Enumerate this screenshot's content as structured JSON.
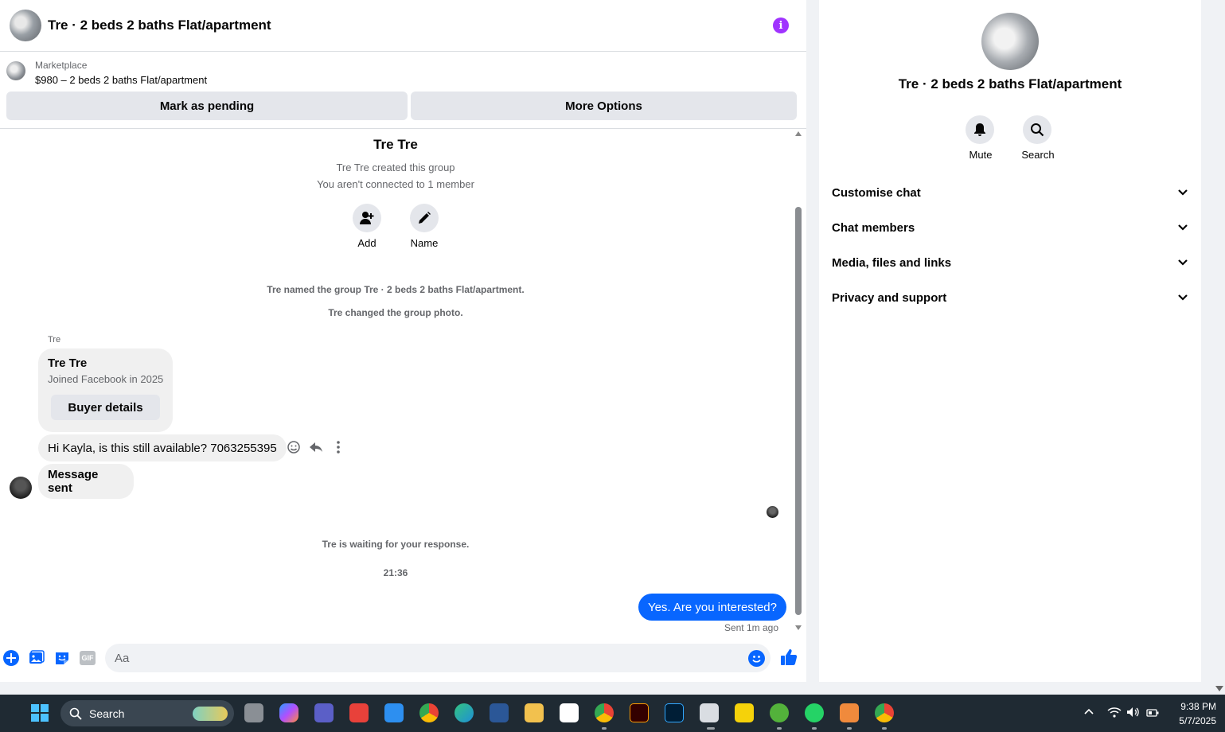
{
  "header": {
    "title": "Tre · 2 beds 2 baths Flat/apartment",
    "info_icon": "info-icon"
  },
  "listing": {
    "source": "Marketplace",
    "price_title": "$980 – 2 beds 2 baths Flat/apartment",
    "mark_pending_label": "Mark as pending",
    "more_options_label": "More Options"
  },
  "thread": {
    "group_name": "Tre Tre",
    "created_text": "Tre Tre created this group",
    "connection_text": "You aren't connected to 1 member",
    "add_label": "Add",
    "name_label": "Name",
    "event_named": "Tre named the group Tre · 2 beds 2 baths Flat/apartment.",
    "event_photo": "Tre changed the group photo.",
    "sender_label": "Tre",
    "card_name": "Tre Tre",
    "card_joined": "Joined Facebook in 2025",
    "buyer_details_label": "Buyer details",
    "incoming_message": "Hi Kayla, is this still available? 7063255395",
    "incoming_status": "Message sent",
    "waiting_text": "Tre is waiting for your response.",
    "timestamp": "21:36",
    "outgoing_message": "Yes. Are you interested?",
    "outgoing_status": "Sent 1m ago"
  },
  "composer": {
    "placeholder": "Aa"
  },
  "right_panel": {
    "title": "Tre · 2 beds 2 baths Flat/apartment",
    "mute_label": "Mute",
    "search_label": "Search",
    "sections": [
      "Customise chat",
      "Chat members",
      "Media, files and links",
      "Privacy and support"
    ]
  },
  "taskbar": {
    "search_label": "Search",
    "time": "9:38 PM",
    "date": "5/7/2025"
  },
  "colors": {
    "accent": "#0866ff",
    "info": "#a033ff",
    "bubble_out": "#0866ff",
    "bubble_in": "#f0f0f0",
    "taskbar": "#1f2a33"
  }
}
